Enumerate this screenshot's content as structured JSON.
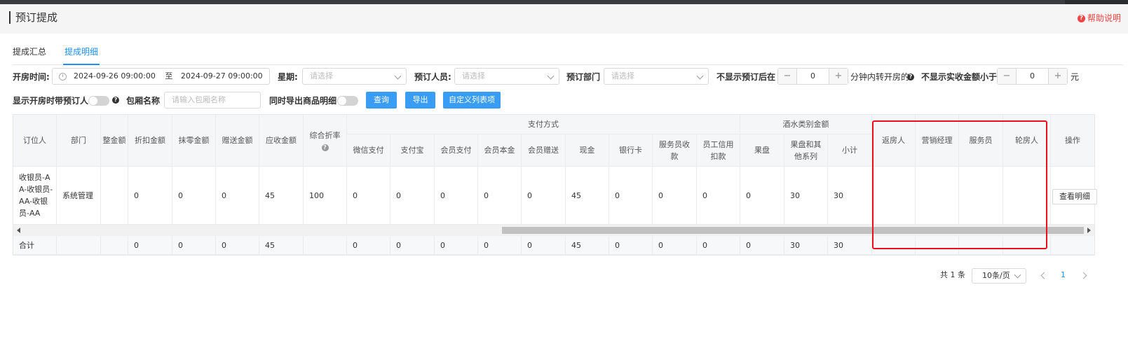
{
  "header": {
    "title": "预订提成",
    "help": "帮助说明"
  },
  "tabs": [
    {
      "label": "提成汇总"
    },
    {
      "label": "提成明细"
    }
  ],
  "filters": {
    "open_time_label": "开房时间:",
    "date_start": "2024-09-26 09:00:00",
    "date_sep": "至",
    "date_end": "2024-09-27 09:00:00",
    "weekday_label": "星期:",
    "select_placeholder": "请选择",
    "booker_label": "预订人员:",
    "dept_label": "预订部门",
    "hide_after_label": "不显示预订后在",
    "hide_after_value": "0",
    "hide_after_suffix": "分钟内转开房的",
    "hide_amount_label": "不显示实收金额小于",
    "hide_amount_value": "0",
    "hide_amount_suffix": "元",
    "show_booker_label": "显示开房时带预订人",
    "room_label": "包厢名称",
    "room_placeholder": "请输入包厢名称",
    "export_goods_label": "同时导出商品明细",
    "query_btn": "查询",
    "export_btn": "导出",
    "custom_cols_btn": "自定义列表项",
    "minus": "−",
    "plus": "+"
  },
  "table": {
    "headers": {
      "booker": "订位人",
      "dept": "部门",
      "adjust": "整金额",
      "discount": "折扣金额",
      "wipe": "抹零金额",
      "gift": "赠送金额",
      "receivable": "应收金额",
      "rate": "综合折率",
      "payment_group": "支付方式",
      "wechat": "微信支付",
      "alipay": "支付宝",
      "member": "会员支付",
      "member_principal": "会员本金",
      "member_gift": "会员赠送",
      "cash": "现金",
      "bank": "银行卡",
      "staff_receipt_1": "服务员收",
      "staff_receipt_2": "款",
      "staff_credit_1": "员工信用",
      "staff_credit_2": "扣款",
      "liquor_group": "酒水类别金额",
      "fruit": "果盘",
      "fruit_other_1": "果盘和其",
      "fruit_other_2": "他系列",
      "subtotal": "小计",
      "referrer": "返房人",
      "marketing": "营销经理",
      "waiter": "服务员",
      "rotation": "轮房人",
      "action": "操作"
    },
    "row": {
      "booker": "收银员-AA-收银员-AA-收银员-AA",
      "dept": "系统管理",
      "discount": "0",
      "wipe": "0",
      "gift": "0",
      "receivable": "45",
      "rate": "100",
      "wechat": "0",
      "alipay": "0",
      "member": "0",
      "member_principal": "0",
      "member_gift": "0",
      "cash": "45",
      "bank": "0",
      "staff_receipt": "0",
      "staff_credit": "0",
      "fruit": "0",
      "fruit_other": "30",
      "subtotal": "30",
      "action": "查看明细"
    },
    "total": {
      "label": "合计",
      "discount": "0",
      "wipe": "0",
      "gift": "0",
      "receivable": "45",
      "wechat": "0",
      "alipay": "0",
      "member": "0",
      "member_principal": "0",
      "member_gift": "0",
      "cash": "45",
      "bank": "0",
      "staff_receipt": "0",
      "staff_credit": "0",
      "fruit": "0",
      "fruit_other": "30",
      "subtotal": "30"
    }
  },
  "pagination": {
    "total": "共 1 条",
    "page_size": "10条/页",
    "current": "1"
  },
  "colors": {
    "accent": "#3a9df5",
    "highlight": "#e8101a"
  }
}
